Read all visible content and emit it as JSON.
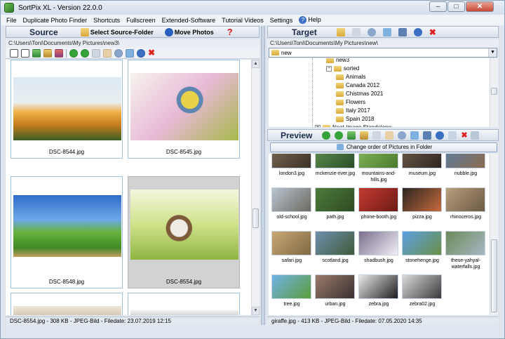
{
  "window": {
    "title": "SortPix XL - Version 22.0.0",
    "controls": [
      "–",
      "□",
      "✕"
    ]
  },
  "menu": [
    "File",
    "Duplicate Photo Finder",
    "Shortcuts",
    "Fullscreen",
    "Extended-Software",
    "Tutorial Videos",
    "Settings",
    "Help"
  ],
  "source": {
    "title": "Source",
    "select_folder": "Select Source-Folder",
    "move_photos": "Move Photos",
    "path": "C:\\Users\\Toni\\Documents\\My Pictures\\new3\\",
    "thumbs": [
      {
        "name": "DSC-8544.jpg",
        "colors": [
          "#e8f0f6",
          "#d99d2b",
          "#4a6b2a"
        ]
      },
      {
        "name": "DSC-8545.jpg",
        "colors": [
          "#f3f2ee",
          "#d86aa7",
          "#7a8f3a"
        ]
      },
      {
        "name": "DSC-8548.jpg",
        "colors": [
          "#3c7fd2",
          "#4b9d2e",
          "#c79e62"
        ]
      },
      {
        "name": "DSC-8554.jpg",
        "colors": [
          "#e7f0c8",
          "#9abe4e",
          "#f4efe0"
        ]
      },
      {
        "name": "",
        "colors": [
          "#e8e3d8",
          "#c9b79a",
          "#8d7a5a"
        ]
      },
      {
        "name": "",
        "colors": [
          "#f1f1f1",
          "#cfcfcf",
          "#999999"
        ]
      }
    ],
    "status": "DSC-8554.jpg - 308 KB - JPEG-Bild - Filedate: 23.07.2019 12:15"
  },
  "target": {
    "title": "Target",
    "path": "C:\\Users\\Toni\\Documents\\My Pictures\\new\\",
    "folder_value": "new",
    "tree": [
      {
        "label": "new3",
        "indent": 1
      },
      {
        "label": "sorted",
        "indent": 1,
        "expand": "−"
      },
      {
        "label": "Animals",
        "indent": 2
      },
      {
        "label": "Canada 2012",
        "indent": 2
      },
      {
        "label": "Chistmas 2021",
        "indent": 2
      },
      {
        "label": "Flowers",
        "indent": 2
      },
      {
        "label": "Italy 2017",
        "indent": 2
      },
      {
        "label": "Spain 2018",
        "indent": 2
      },
      {
        "label": "Neat Image Standalone",
        "indent": 0,
        "expand": "+"
      }
    ],
    "status": "giraffe.jpg - 413 KB - JPEG-Bild - Filedate: 07.05.2020 14:35"
  },
  "preview": {
    "title": "Preview",
    "change_order": "Change order of Pictures in Folder",
    "items": [
      {
        "name": "london3.jpg",
        "colors": [
          "#7a6a55",
          "#3c3026"
        ]
      },
      {
        "name": "mckenzie-river.jpg",
        "colors": [
          "#5f8f4e",
          "#2b4e2a"
        ]
      },
      {
        "name": "mountains-and-hills.jpg",
        "colors": [
          "#86b75a",
          "#4a7b2e"
        ]
      },
      {
        "name": "museum.jpg",
        "colors": [
          "#6b5a4a",
          "#2f2620"
        ]
      },
      {
        "name": "nubble.jpg",
        "colors": [
          "#5a7fa6",
          "#8a6a4b"
        ]
      },
      {
        "name": "old-school.jpg",
        "colors": [
          "#b9c4cf",
          "#6d6a62"
        ]
      },
      {
        "name": "path.jpg",
        "colors": [
          "#4d7a3a",
          "#2f4c23"
        ]
      },
      {
        "name": "phone-booth.jpg",
        "colors": [
          "#c23a30",
          "#6d1b15"
        ]
      },
      {
        "name": "pizza.jpg",
        "colors": [
          "#2b2622",
          "#c86a3a"
        ]
      },
      {
        "name": "rhinoceros.jpg",
        "colors": [
          "#b89f7e",
          "#6c5a44"
        ]
      },
      {
        "name": "safari.jpg",
        "colors": [
          "#c9a773",
          "#7f6a45"
        ]
      },
      {
        "name": "scotland.jpg",
        "colors": [
          "#6f8fae",
          "#3e5b38"
        ]
      },
      {
        "name": "shadbush.jpg",
        "colors": [
          "#7a6f8e",
          "#f2eef5"
        ]
      },
      {
        "name": "stonehenge.jpg",
        "colors": [
          "#5aa0e0",
          "#6c8f48"
        ]
      },
      {
        "name": "these-yahyal-waterfalls.jpg",
        "colors": [
          "#6c8a5a",
          "#a7b8c2"
        ]
      },
      {
        "name": "tree.jpg",
        "colors": [
          "#6fb1e6",
          "#5c9e3a"
        ]
      },
      {
        "name": "urban.jpg",
        "colors": [
          "#9a7a6a",
          "#3a2f2f"
        ]
      },
      {
        "name": "zebra.jpg",
        "colors": [
          "#e9e9e9",
          "#1e1e1e"
        ]
      },
      {
        "name": "zebra02.jpg",
        "colors": [
          "#dadada",
          "#3a3a3a"
        ]
      }
    ]
  }
}
